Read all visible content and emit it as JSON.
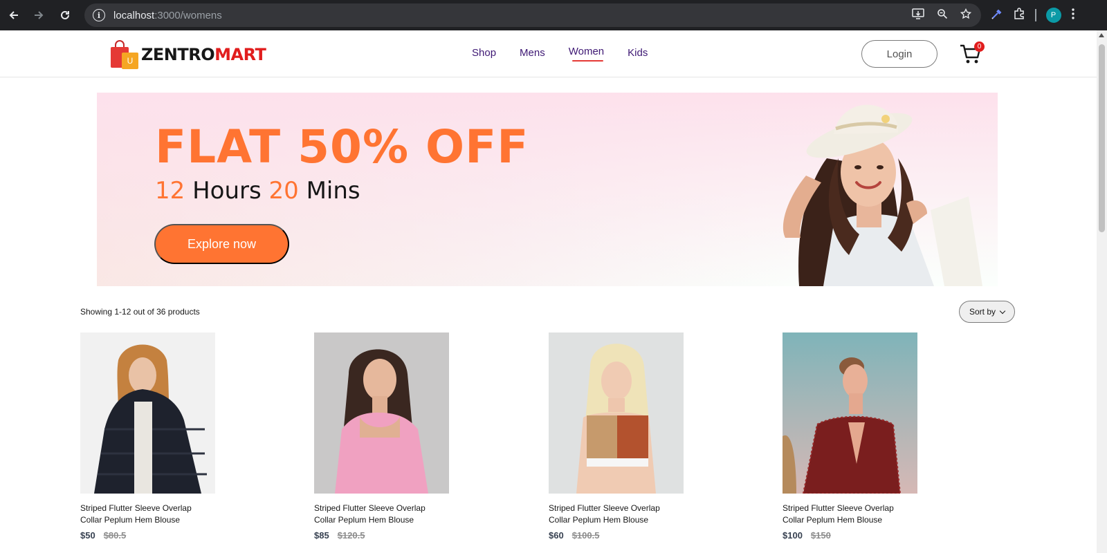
{
  "browser": {
    "url_host": "localhost",
    "url_rest": ":3000/womens",
    "profile_initial": "P"
  },
  "site": {
    "logo_part1": "ZENTRO",
    "logo_part2": "MART",
    "logo_bag_letter": "U",
    "nav": [
      {
        "label": "Shop"
      },
      {
        "label": "Mens"
      },
      {
        "label": "Women"
      },
      {
        "label": "Kids"
      }
    ],
    "login_label": "Login",
    "cart_count": "0"
  },
  "hero": {
    "title": "FLAT 50% OFF",
    "hours_value": "12",
    "hours_label": "Hours",
    "mins_value": "20",
    "mins_label": "Mins",
    "button_label": "Explore now"
  },
  "listing": {
    "showing_text": "Showing 1-12 out of 36 products",
    "sort_label": "Sort by"
  },
  "products": [
    {
      "name": "Striped Flutter Sleeve Overlap Collar Peplum Hem Blouse",
      "new_price": "$50",
      "old_price": "$80.5"
    },
    {
      "name": "Striped Flutter Sleeve Overlap Collar Peplum Hem Blouse",
      "new_price": "$85",
      "old_price": "$120.5"
    },
    {
      "name": "Striped Flutter Sleeve Overlap Collar Peplum Hem Blouse",
      "new_price": "$60",
      "old_price": "$100.5"
    },
    {
      "name": "Striped Flutter Sleeve Overlap Collar Peplum Hem Blouse",
      "new_price": "$100",
      "old_price": "$150"
    }
  ],
  "colors": {
    "accent_orange": "#ff7432",
    "nav_purple": "#3e1874",
    "logo_red": "#e11d1d"
  }
}
